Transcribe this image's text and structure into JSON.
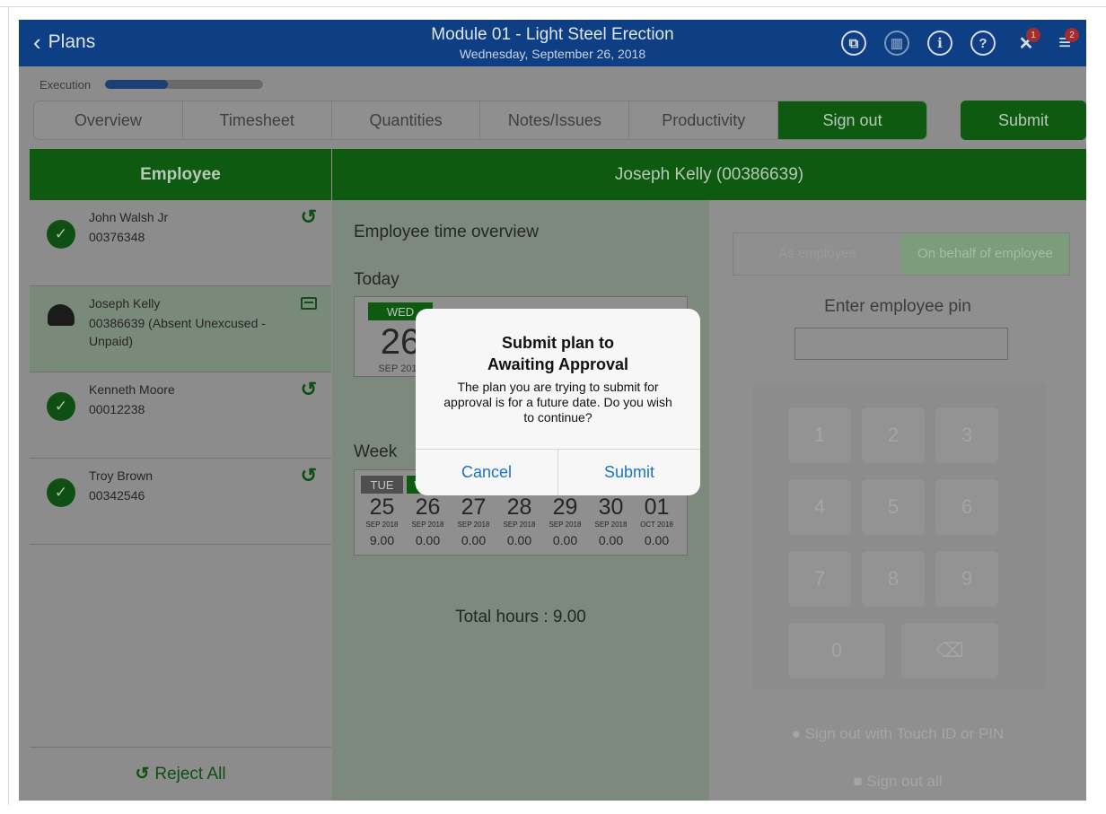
{
  "header": {
    "back_label": "Plans",
    "title": "Module 01 - Light Steel Erection",
    "subtitle": "Wednesday, September 26, 2018",
    "icons": [
      "copy-icon",
      "trash-icon",
      "info-icon",
      "help-icon",
      "notifications-icon",
      "menu-icon"
    ],
    "notification_badge": "1",
    "menu_badge": "2"
  },
  "execution": {
    "label": "Execution",
    "progress": 0.4
  },
  "tabs": [
    {
      "label": "Overview"
    },
    {
      "label": "Timesheet"
    },
    {
      "label": "Quantities"
    },
    {
      "label": "Notes/Issues"
    },
    {
      "label": "Productivity"
    },
    {
      "label": "Sign out",
      "active": true
    }
  ],
  "submit_label": "Submit",
  "employees_header": "Employee",
  "employees": [
    {
      "name": "John Walsh Jr",
      "id": "00376348",
      "status": "approved"
    },
    {
      "name": "Joseph Kelly",
      "id": "00386639 (Absent Unexcused - Unpaid)",
      "status": "absent"
    },
    {
      "name": "Kenneth Moore",
      "id": "00012238",
      "status": "approved"
    },
    {
      "name": "Troy Brown",
      "id": "00342546",
      "status": "approved"
    }
  ],
  "reject_all_label": "Reject All",
  "detail": {
    "header": "Joseph Kelly (00386639)",
    "overview_title": "Employee time overview",
    "today_label": "Today",
    "today": {
      "day": "WED",
      "num": "26",
      "month": "SEP 2018"
    },
    "week_label": "Week",
    "week": [
      {
        "day": "TUE",
        "num": "25",
        "month": "SEP 2018",
        "hours": "9.00"
      },
      {
        "day": "WED",
        "num": "26",
        "month": "SEP 2018",
        "hours": "0.00",
        "active": true
      },
      {
        "day": "",
        "num": "27",
        "month": "SEP 2018",
        "hours": "0.00"
      },
      {
        "day": "",
        "num": "28",
        "month": "SEP 2018",
        "hours": "0.00"
      },
      {
        "day": "",
        "num": "29",
        "month": "SEP 2018",
        "hours": "0.00"
      },
      {
        "day": "",
        "num": "30",
        "month": "SEP 2018",
        "hours": "0.00"
      },
      {
        "day": "",
        "num": "01",
        "month": "OCT 2018",
        "hours": "0.00"
      }
    ],
    "total_label": "Total hours : 9.00"
  },
  "signout": {
    "as_employee": "As employee",
    "on_behalf": "On behalf of employee",
    "pin_label": "Enter employee pin",
    "pin_value": "",
    "keys": [
      "1",
      "2",
      "3",
      "4",
      "5",
      "6",
      "7",
      "8",
      "9",
      "0"
    ],
    "touch_label": "Sign out with Touch ID or PIN",
    "sign_all_label": "Sign out all"
  },
  "dialog": {
    "title_line1": "Submit plan to",
    "title_line2": "Awaiting Approval",
    "message": "The plan you are trying to submit for approval is for a future date. Do you wish to continue?",
    "cancel_label": "Cancel",
    "submit_label": "Submit"
  },
  "colors": {
    "brand_green": "#138a17",
    "header_blue": "#0f54ab",
    "link_blue": "#1a73c8"
  }
}
